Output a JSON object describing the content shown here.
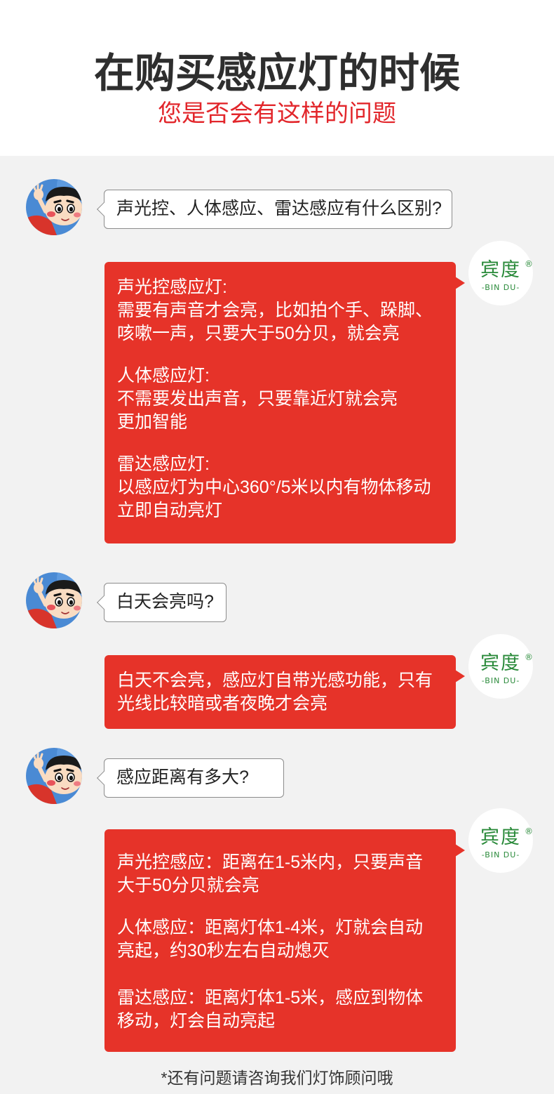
{
  "header": {
    "title": "在购买感应灯的时候",
    "subtitle": "您是否会有这样的问题"
  },
  "brand_logo": {
    "name": "宾度",
    "registered_mark": "®",
    "latin": "-BIN DU-"
  },
  "chat": [
    {
      "question": "声光控、人体感应、雷达感应有什么区别?",
      "answer": [
        [
          "声光控感应灯:",
          "需要有声音才会亮，比如拍个手、跺脚、",
          "咳嗽一声，只要大于50分贝，就会亮"
        ],
        [
          "人体感应灯:",
          "不需要发出声音，只要靠近灯就会亮",
          "更加智能"
        ],
        [
          "雷达感应灯:",
          "以感应灯为中心360°/5米以内有物体移动",
          "立即自动亮灯"
        ]
      ]
    },
    {
      "question": "白天会亮吗?",
      "answer": [
        [
          "白天不会亮，感应灯自带光感功能，只有",
          "光线比较暗或者夜晚才会亮"
        ]
      ]
    },
    {
      "question": "感应距离有多大?",
      "answer": [
        [
          "声光控感应：距离在1-5米内，只要声音",
          "大于50分贝就会亮"
        ],
        [
          "人体感应：距离灯体1-4米，灯就会自动",
          "亮起，约30秒左右自动熄灭"
        ],
        [
          "雷达感应：距离灯体1-5米，感应到物体",
          "移动，灯会自动亮起"
        ]
      ]
    }
  ],
  "footer": {
    "note": "*还有问题请咨询我们灯饰顾问哦"
  },
  "icons": {
    "customer_avatar": "cartoon-boy-avatar-icon",
    "brand_logo": "bindu-logo"
  },
  "colors": {
    "page_background": "#f2f2f2",
    "header_background": "#ffffff",
    "title": "#2e2e2e",
    "subtitle": "#e2262b",
    "answer_bubble": "#e63329",
    "question_border": "#8c8c8c",
    "brand_green": "#2a8a3a"
  }
}
